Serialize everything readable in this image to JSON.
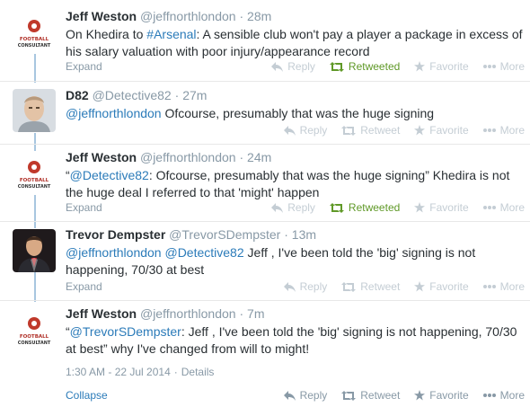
{
  "tweets": [
    {
      "name": "Jeff Weston",
      "handle": "@jeffnorthlondon",
      "time": "28m",
      "text_parts": [
        "On Khedira to ",
        "#Arsenal",
        ": A sensible club won't pay a player a package in excess of his salary valuation with poor injury/appearance record"
      ],
      "footer": {
        "expand": "Expand",
        "reply": "Reply",
        "retweet": "Retweeted",
        "favorite": "Favorite",
        "more": "More"
      }
    },
    {
      "name": "D82",
      "handle": "@Detective82",
      "time": "27m",
      "text_parts": [
        "@jeffnorthlondon",
        " Ofcourse, presumably that was the huge signing"
      ],
      "footer": {
        "expand": "Expand",
        "reply": "Reply",
        "retweet": "Retweet",
        "favorite": "Favorite",
        "more": "More"
      }
    },
    {
      "name": "Jeff Weston",
      "handle": "@jeffnorthlondon",
      "time": "24m",
      "text_parts": [
        "“",
        "@Detective82",
        ": Ofcourse, presumably that was the huge signing” Khedira is not the huge deal I referred to that 'might' happen"
      ],
      "footer": {
        "expand": "Expand",
        "reply": "Reply",
        "retweet": "Retweeted",
        "favorite": "Favorite",
        "more": "More"
      }
    },
    {
      "name": "Trevor Dempster",
      "handle": "@TrevorSDempster",
      "time": "13m",
      "text_parts": [
        "@jeffnorthlondon",
        " ",
        "@Detective82",
        " Jeff , I've been told the 'big' signing is not happening, 70/30 at best"
      ],
      "footer": {
        "expand": "Expand",
        "reply": "Reply",
        "retweet": "Retweet",
        "favorite": "Favorite",
        "more": "More"
      }
    },
    {
      "name": "Jeff Weston",
      "handle": "@jeffnorthlondon",
      "time": "7m",
      "text_parts": [
        "“",
        "@TrevorSDempster",
        ": Jeff , I've been told the 'big' signing is not happening, 70/30 at best” why I've changed from will to might!"
      ],
      "meta": {
        "timestamp": "1:30 AM - 22 Jul 2014",
        "details": "Details"
      },
      "footer": {
        "expand": "Collapse",
        "reply": "Reply",
        "retweet": "Retweet",
        "favorite": "Favorite",
        "more": "More"
      }
    }
  ],
  "avatar_logo": {
    "line1": "FOOTBALL",
    "line2": "CONSULTANT"
  },
  "colors": {
    "link": "#2b7bb9",
    "retweeted": "#609928",
    "thread_line": "#a8c6e0"
  }
}
